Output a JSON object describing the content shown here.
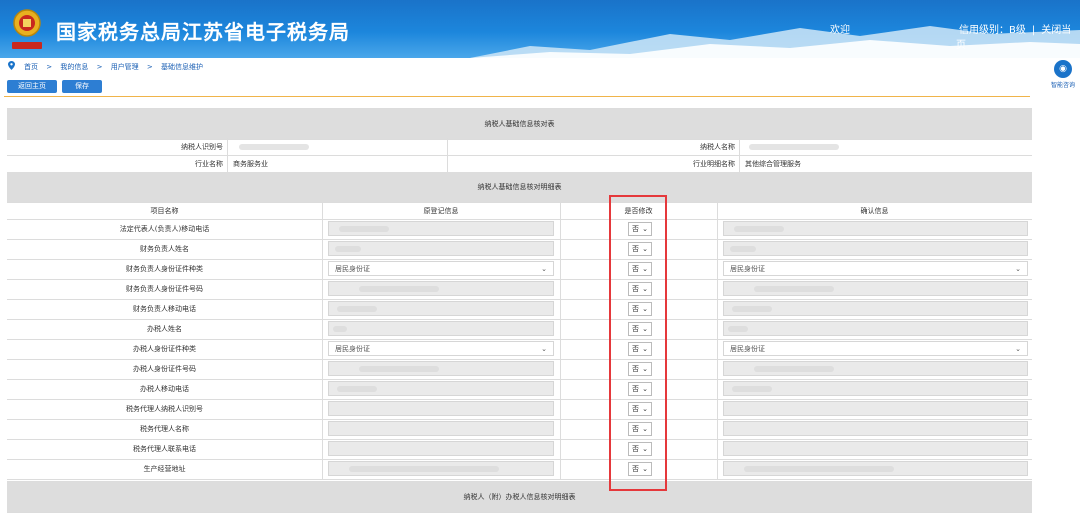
{
  "header": {
    "title": "国家税务总局江苏省电子税务局",
    "welcome": "欢迎",
    "credit_rating": "信用级别：B级",
    "close_page": "关闭当页"
  },
  "breadcrumb": [
    "首页",
    ">",
    "我的信息",
    ">",
    "用户管理",
    ">",
    "基础信息维护"
  ],
  "toolbar": {
    "back_label": "返回主页",
    "save_label": "保存"
  },
  "assistant": {
    "label": "智能咨询"
  },
  "section1": {
    "title": "纳税人基础信息核对表",
    "taxpayer_id_label": "纳税人识别号",
    "taxpayer_name_label": "纳税人名称",
    "industry_label": "行业名称",
    "industry_value": "商务服务业",
    "industry_detail_label": "行业明细名称",
    "industry_detail_value": "其他综合管理服务"
  },
  "section2": {
    "title": "纳税人基础信息核对明细表",
    "columns": [
      "项目名称",
      "原登记信息",
      "是否修改",
      "确认信息"
    ],
    "rows": [
      {
        "name": "法定代表人(负责人)移动电话",
        "original": "",
        "modify": "否",
        "confirm": ""
      },
      {
        "name": "财务负责人姓名",
        "original": "",
        "modify": "否",
        "confirm": ""
      },
      {
        "name": "财务负责人身份证件种类",
        "original": "居民身份证",
        "modify": "否",
        "confirm": "居民身份证"
      },
      {
        "name": "财务负责人身份证件号码",
        "original": "",
        "modify": "否",
        "confirm": ""
      },
      {
        "name": "财务负责人移动电话",
        "original": "",
        "modify": "否",
        "confirm": ""
      },
      {
        "name": "办税人姓名",
        "original": "",
        "modify": "否",
        "confirm": ""
      },
      {
        "name": "办税人身份证件种类",
        "original": "居民身份证",
        "modify": "否",
        "confirm": "居民身份证"
      },
      {
        "name": "办税人身份证件号码",
        "original": "",
        "modify": "否",
        "confirm": ""
      },
      {
        "name": "办税人移动电话",
        "original": "",
        "modify": "否",
        "confirm": ""
      },
      {
        "name": "税务代理人纳税人识别号",
        "original": "",
        "modify": "否",
        "confirm": ""
      },
      {
        "name": "税务代理人名称",
        "original": "",
        "modify": "否",
        "confirm": ""
      },
      {
        "name": "税务代理人联系电话",
        "original": "",
        "modify": "否",
        "confirm": ""
      },
      {
        "name": "生产经营地址",
        "original": "",
        "modify": "否",
        "confirm": ""
      }
    ]
  },
  "section3": {
    "title": "纳税人（附）办税人信息核对明细表"
  }
}
